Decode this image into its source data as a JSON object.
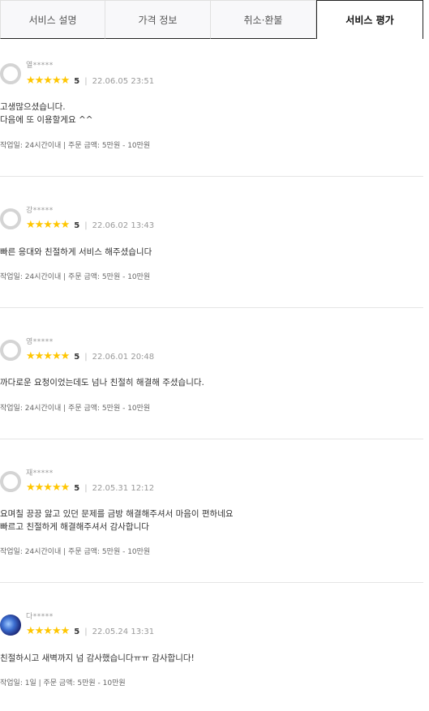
{
  "tabs": [
    {
      "label": "서비스 설명"
    },
    {
      "label": "가격 정보"
    },
    {
      "label": "취소·환불"
    },
    {
      "label": "서비스 평가"
    }
  ],
  "reviews": [
    {
      "name": "열*****",
      "stars": "★★★★★",
      "score": "5",
      "sep": "|",
      "date": "22.06.05 23:51",
      "lines": [
        "고생많으셨습니다.",
        "다음에 또 이용할게요 ^^"
      ],
      "info": "작업일: 24시간이내 | 주문 금액: 5만원 - 10만원"
    },
    {
      "name": "강*****",
      "stars": "★★★★★",
      "score": "5",
      "sep": "|",
      "date": "22.06.02 13:43",
      "lines": [
        "빠른 응대와 친절하게 서비스 해주셨습니다"
      ],
      "info": "작업일: 24시간이내 | 주문 금액: 5만원 - 10만원"
    },
    {
      "name": "영*****",
      "stars": "★★★★★",
      "score": "5",
      "sep": "|",
      "date": "22.06.01 20:48",
      "lines": [
        "까다로운 요청이었는데도 넘나 친절히 해결해 주셨습니다."
      ],
      "info": "작업일: 24시간이내 | 주문 금액: 5만원 - 10만원"
    },
    {
      "name": "재*****",
      "stars": "★★★★★",
      "score": "5",
      "sep": "|",
      "date": "22.05.31 12:12",
      "lines": [
        "요며칠 끙끙 앓고 있던 문제를 금방 해결해주셔서 마음이 편하네요",
        "빠르고 친절하게 해결해주셔서 감사합니다"
      ],
      "info": "작업일: 24시간이내 | 주문 금액: 5만원 - 10만원"
    },
    {
      "name": "다*****",
      "stars": "★★★★★",
      "score": "5",
      "sep": "|",
      "date": "22.05.24 13:31",
      "lines": [
        "친절하시고 새벽까지 넘 감사했습니다ㅠㅠ 감사합니다!"
      ],
      "info": "작업일: 1일 | 주문 금액: 5만원 - 10만원"
    }
  ]
}
